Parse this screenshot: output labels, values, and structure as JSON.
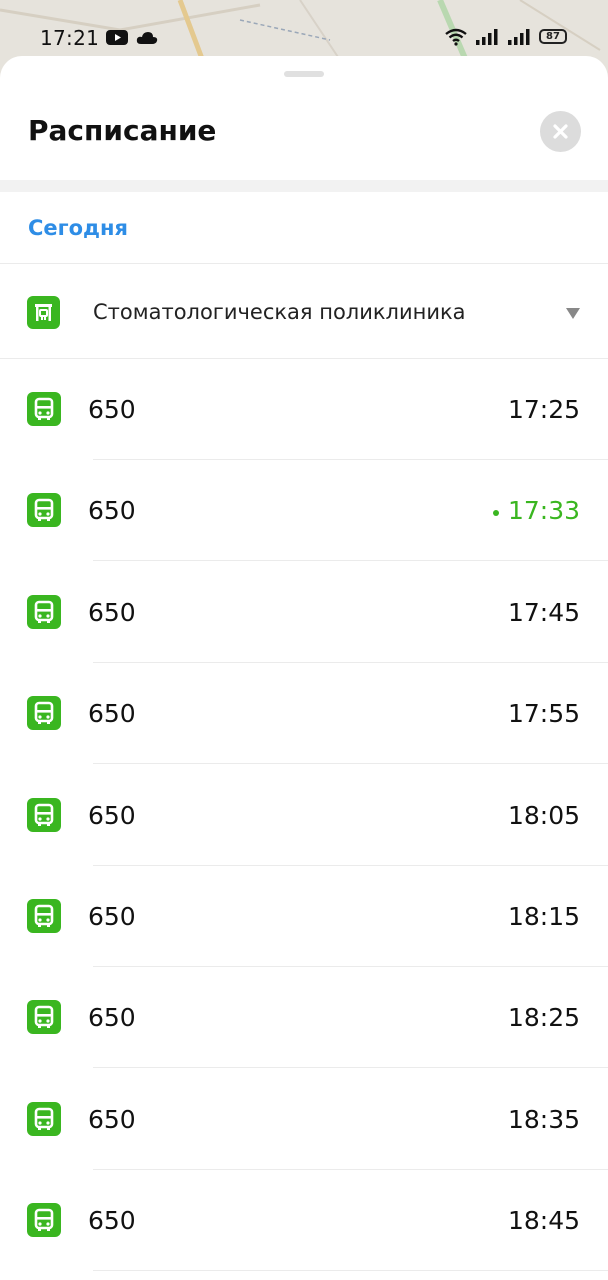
{
  "status_bar": {
    "time": "17:21",
    "battery": "87",
    "icons": [
      "youtube-icon",
      "cloud-icon",
      "wifi-icon",
      "signal-icon",
      "signal-icon",
      "battery-icon"
    ]
  },
  "sheet": {
    "title": "Расписание",
    "close_icon": "close-icon",
    "day_label": "Сегодня",
    "stop": {
      "name": "Стоматологическая поликлиника",
      "icon": "bus-stop-icon"
    }
  },
  "colors": {
    "accent_green": "#3ab620",
    "link_blue": "#2e8de6"
  },
  "schedule": [
    {
      "route": "650",
      "time": "17:25",
      "next": false
    },
    {
      "route": "650",
      "time": "17:33",
      "next": true
    },
    {
      "route": "650",
      "time": "17:45",
      "next": false
    },
    {
      "route": "650",
      "time": "17:55",
      "next": false
    },
    {
      "route": "650",
      "time": "18:05",
      "next": false
    },
    {
      "route": "650",
      "time": "18:15",
      "next": false
    },
    {
      "route": "650",
      "time": "18:25",
      "next": false
    },
    {
      "route": "650",
      "time": "18:35",
      "next": false
    },
    {
      "route": "650",
      "time": "18:45",
      "next": false
    }
  ]
}
